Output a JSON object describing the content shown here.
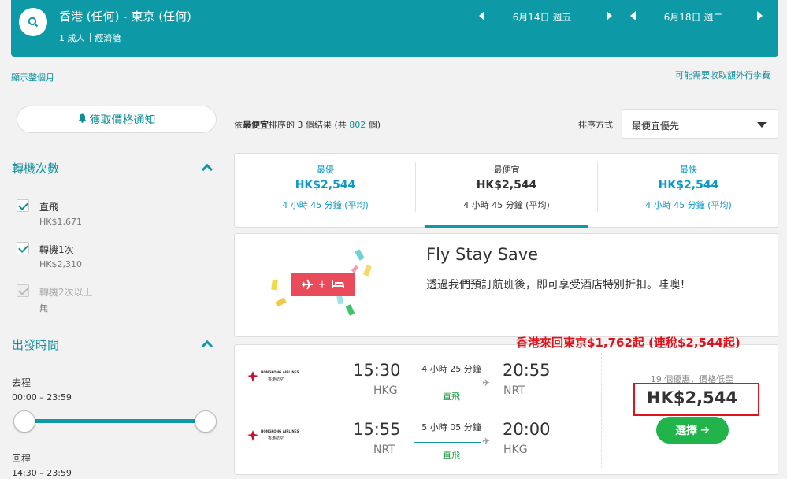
{
  "header": {
    "route": "香港 (任何) - 東京 (任何)",
    "pax": "1 成人",
    "cabin": "經濟艙",
    "depart_date": "6月14日 週五",
    "return_date": "6月18日 週二"
  },
  "links": {
    "show_month": "顯示整個月",
    "baggage_fee": "可能需要收取額外行李費"
  },
  "sidebar": {
    "price_alert": "獲取價格通知",
    "stops_title": "轉機次數",
    "stops": [
      {
        "label": "直飛",
        "price": "HK$1,671"
      },
      {
        "label": "轉機1次",
        "price": "HK$2,310"
      },
      {
        "label": "轉機2次以上",
        "price": "無"
      }
    ],
    "time_title": "出發時間",
    "outbound_label": "去程",
    "outbound_range": "00:00 – 23:59",
    "return_label": "回程",
    "return_range": "14:30 – 23:59"
  },
  "results": {
    "prefix": "依",
    "sort_word": "最便宜",
    "middle": "排序的 3 個結果 (共",
    "total": "802",
    "suffix": "個)",
    "sort_label": "排序方式",
    "sort_value": "最便宜優先"
  },
  "tabs": [
    {
      "title": "最優",
      "price": "HK$2,544",
      "duration": "4 小時 45 分鐘 (平均)"
    },
    {
      "title": "最便宜",
      "price": "HK$2,544",
      "duration": "4 小時 45 分鐘 (平均)"
    },
    {
      "title": "最快",
      "price": "HK$2,544",
      "duration": "4 小時 45 分鐘 (平均)"
    }
  ],
  "promo": {
    "title": "Fly Stay Save",
    "desc": "透過我們預訂航班後，即可享受酒店特別折扣。哇噢！",
    "pill_plus": "+"
  },
  "flight": {
    "overlay": "香港來回東京$1,762起 (連稅$2,544起)",
    "airline_en": "HONGKONG AIRLINES",
    "airline_zh": "香港航空",
    "legs": [
      {
        "dep_time": "15:30",
        "dep_code": "HKG",
        "duration": "4 小時 25 分鐘",
        "stops": "直飛",
        "arr_time": "20:55",
        "arr_code": "NRT"
      },
      {
        "dep_time": "15:55",
        "dep_code": "NRT",
        "duration": "5 小時 05 分鐘",
        "stops": "直飛",
        "arr_time": "20:00",
        "arr_code": "HKG"
      }
    ],
    "deals": "19 個優惠，價格低至",
    "price": "HK$2,544",
    "select": "選擇"
  },
  "colors": {
    "teal": "#0d99a6",
    "red": "#e0121b",
    "green": "#20b44a"
  }
}
